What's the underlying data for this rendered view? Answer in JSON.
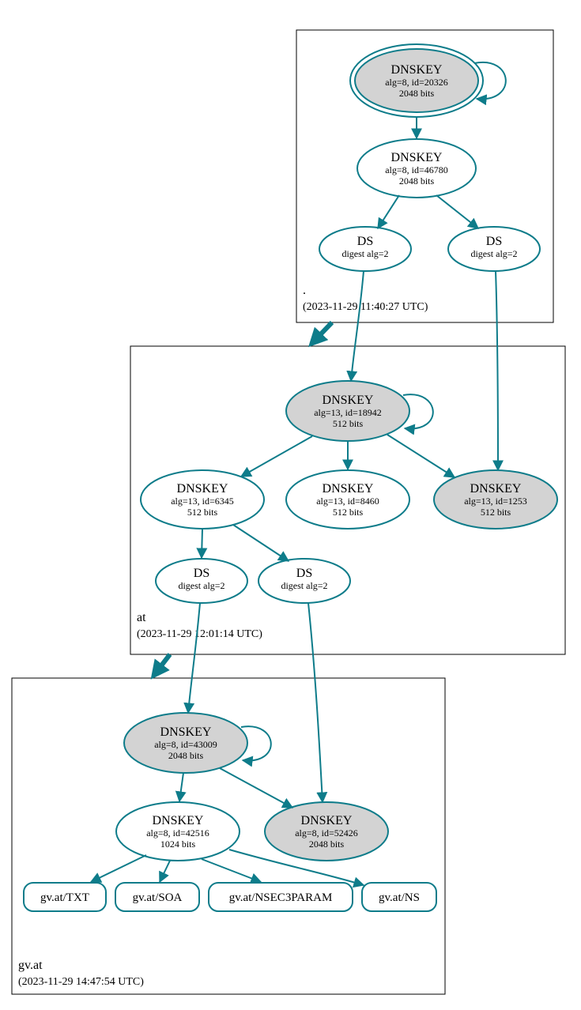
{
  "colors": {
    "stroke": "#0e7c8a",
    "fillGrey": "#d3d3d3"
  },
  "clusters": {
    "root": {
      "title": ".",
      "subtitle": "(2023-11-29 11:40:27 UTC)"
    },
    "at": {
      "title": "at",
      "subtitle": "(2023-11-29 12:01:14 UTC)"
    },
    "gvat": {
      "title": "gv.at",
      "subtitle": "(2023-11-29 14:47:54 UTC)"
    }
  },
  "nodes": {
    "root_key1": {
      "t": "DNSKEY",
      "s1": "alg=8, id=20326",
      "s2": "2048 bits"
    },
    "root_key2": {
      "t": "DNSKEY",
      "s1": "alg=8, id=46780",
      "s2": "2048 bits"
    },
    "root_ds1": {
      "t": "DS",
      "s1": "digest alg=2"
    },
    "root_ds2": {
      "t": "DS",
      "s1": "digest alg=2"
    },
    "at_key_top": {
      "t": "DNSKEY",
      "s1": "alg=13, id=18942",
      "s2": "512 bits"
    },
    "at_key_l": {
      "t": "DNSKEY",
      "s1": "alg=13, id=6345",
      "s2": "512 bits"
    },
    "at_key_m": {
      "t": "DNSKEY",
      "s1": "alg=13, id=8460",
      "s2": "512 bits"
    },
    "at_key_r": {
      "t": "DNSKEY",
      "s1": "alg=13, id=1253",
      "s2": "512 bits"
    },
    "at_ds1": {
      "t": "DS",
      "s1": "digest alg=2"
    },
    "at_ds2": {
      "t": "DS",
      "s1": "digest alg=2"
    },
    "gv_key_top": {
      "t": "DNSKEY",
      "s1": "alg=8, id=43009",
      "s2": "2048 bits"
    },
    "gv_key_l": {
      "t": "DNSKEY",
      "s1": "alg=8, id=42516",
      "s2": "1024 bits"
    },
    "gv_key_r": {
      "t": "DNSKEY",
      "s1": "alg=8, id=52426",
      "s2": "2048 bits"
    },
    "leaf_txt": {
      "t": "gv.at/TXT"
    },
    "leaf_soa": {
      "t": "gv.at/SOA"
    },
    "leaf_nsec3": {
      "t": "gv.at/NSEC3PARAM"
    },
    "leaf_ns": {
      "t": "gv.at/NS"
    }
  }
}
